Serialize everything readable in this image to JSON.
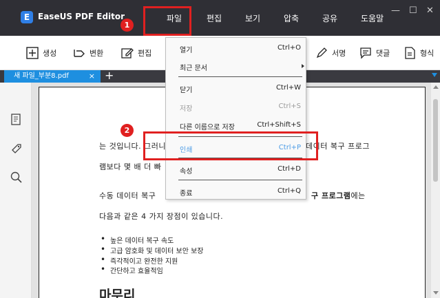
{
  "app": {
    "title": "EaseUS PDF Editor",
    "logo_letter": "E"
  },
  "menu": [
    "파일",
    "편집",
    "보기",
    "압축",
    "공유",
    "도움말"
  ],
  "window_controls": {
    "minimize": "—",
    "maximize": "☐",
    "close": "✕"
  },
  "toolbar": {
    "create": "생성",
    "convert": "변환",
    "edit": "편집",
    "sign": "서명",
    "comment": "댓글",
    "form": "형식"
  },
  "tab": {
    "name": "새 파일_부분8.pdf",
    "close": "×",
    "add": "+"
  },
  "document": {
    "line1_left": "는 것입니다. 그러니",
    "line1_right": "데이터 복구 프로그",
    "line2_left": "램보다 몇 배 더 빠",
    "line3_left": "수동 데이터 복구",
    "line3_right_bold": "구 프로그램",
    "line3_right_tail": "에는",
    "line4": "다음과 같은 4 가지 장점이 있습니다.",
    "bullets": [
      "높은 데이터 복구 속도",
      "고급 암호화 및 데이터 보안 보장",
      "즉각적이고 완전한 지원",
      "간단하고 효율적임"
    ],
    "heading": "마무리"
  },
  "file_menu": {
    "items": [
      {
        "label": "열기",
        "shortcut": "Ctrl+O"
      },
      {
        "label": "최근 문서",
        "shortcut": ""
      },
      {
        "label": "닫기",
        "shortcut": "Ctrl+W"
      },
      {
        "label": "저장",
        "shortcut": "Ctrl+S"
      },
      {
        "label": "다른 이름으로 저장",
        "shortcut": "Ctrl+Shift+S"
      },
      {
        "label": "인쇄",
        "shortcut": "Ctrl+P"
      },
      {
        "label": "속성",
        "shortcut": "Ctrl+D"
      },
      {
        "label": "종료",
        "shortcut": "Ctrl+Q"
      }
    ]
  },
  "annotations": {
    "step1": "1",
    "step2": "2"
  },
  "colors": {
    "titlebar": "#2f2f35",
    "accent": "#1e8fe0",
    "annotation": "#e02020",
    "highlight_text": "#4b9be6"
  }
}
